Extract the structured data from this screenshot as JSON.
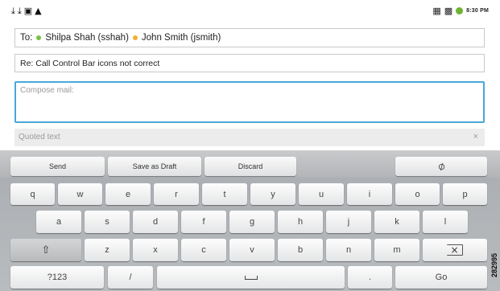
{
  "status_bar": {
    "left_icons": [
      "download-icon",
      "download-icon",
      "image-icon",
      "warning-icon"
    ],
    "right_icons": [
      "signal-icon",
      "wifi-icon",
      "battery-icon"
    ],
    "time": "8:30 PM"
  },
  "to_field": {
    "prefix": "To:",
    "recipients": [
      {
        "name": "Shilpa Shah (sshah)",
        "status_color": "#79c143"
      },
      {
        "name": "John Smith (jsmith)",
        "status_color": "#f0b030"
      }
    ]
  },
  "subject_field": {
    "value": "Re: Call Control Bar icons not correct"
  },
  "compose_field": {
    "placeholder": "Compose mail:"
  },
  "quoted_text": {
    "label": "Quoted text",
    "close": "×"
  },
  "action_bar": {
    "send": "Send",
    "save_draft": "Save as Draft",
    "discard": "Discard",
    "attach_icon": "paperclip-icon"
  },
  "keyboard": {
    "row1": [
      "q",
      "w",
      "e",
      "r",
      "t",
      "y",
      "u",
      "i",
      "o",
      "p"
    ],
    "row2": [
      "a",
      "s",
      "d",
      "f",
      "g",
      "h",
      "j",
      "k",
      "l"
    ],
    "row3": [
      "z",
      "x",
      "c",
      "v",
      "b",
      "n",
      "m"
    ],
    "symbols": "?123",
    "slash": "/",
    "period": ".",
    "go": "Go"
  },
  "figure_id": "282995",
  "colors": {
    "focus": "#49a8d8",
    "online": "#79c143",
    "away": "#f0b030"
  }
}
